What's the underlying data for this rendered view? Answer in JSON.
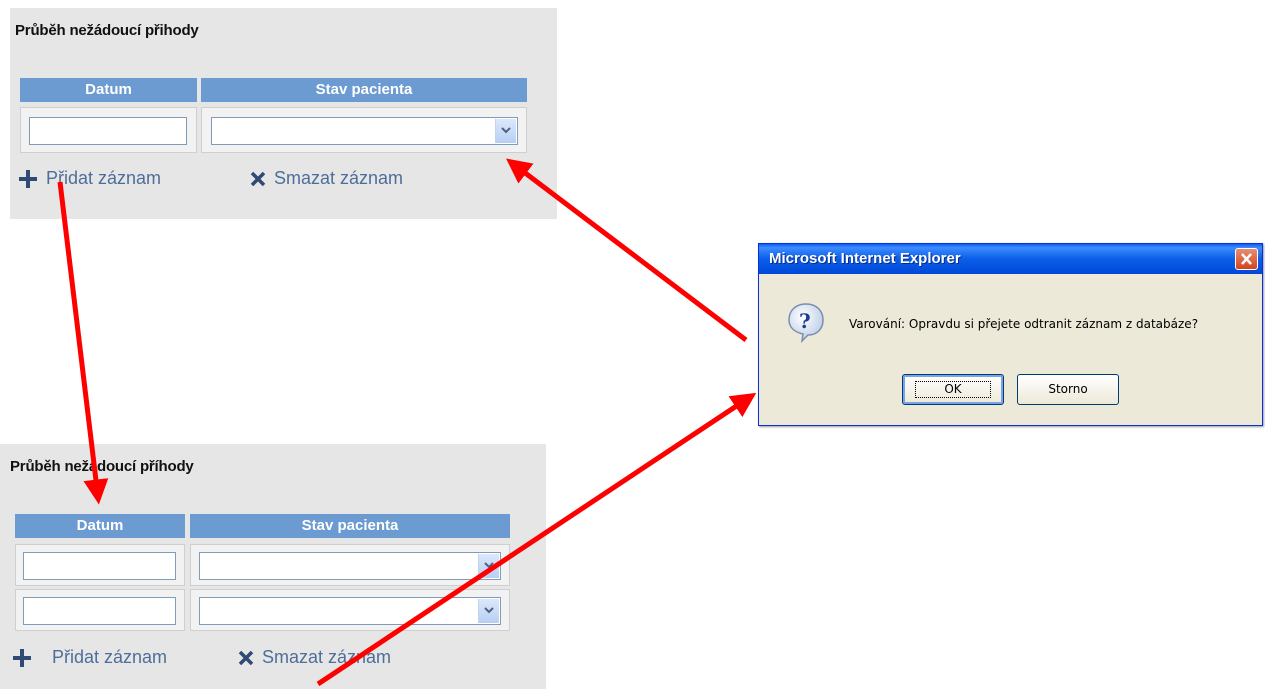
{
  "panel_top": {
    "title": "Průběh nežádoucí přihody",
    "col_date": "Datum",
    "col_state": "Stav pacienta",
    "add_label": "Přidat záznam",
    "delete_label": "Smazat záznam"
  },
  "panel_bottom": {
    "title": "Průběh nežádoucí příhody",
    "col_date": "Datum",
    "col_state": "Stav pacienta",
    "add_label": "Přidat záznam",
    "delete_label": "Smazat záznam"
  },
  "dialog": {
    "title": "Microsoft Internet Explorer",
    "message": "Varování: Opravdu si přejete odtranit záznam z databáze?",
    "ok_label": "OK",
    "cancel_label": "Storno",
    "icon": "question-icon"
  },
  "colors": {
    "header_blue": "#6b9bd1",
    "action_text": "#4e6e9a",
    "arrow_red": "#ff0000",
    "xp_title": "#0a5ee8"
  }
}
